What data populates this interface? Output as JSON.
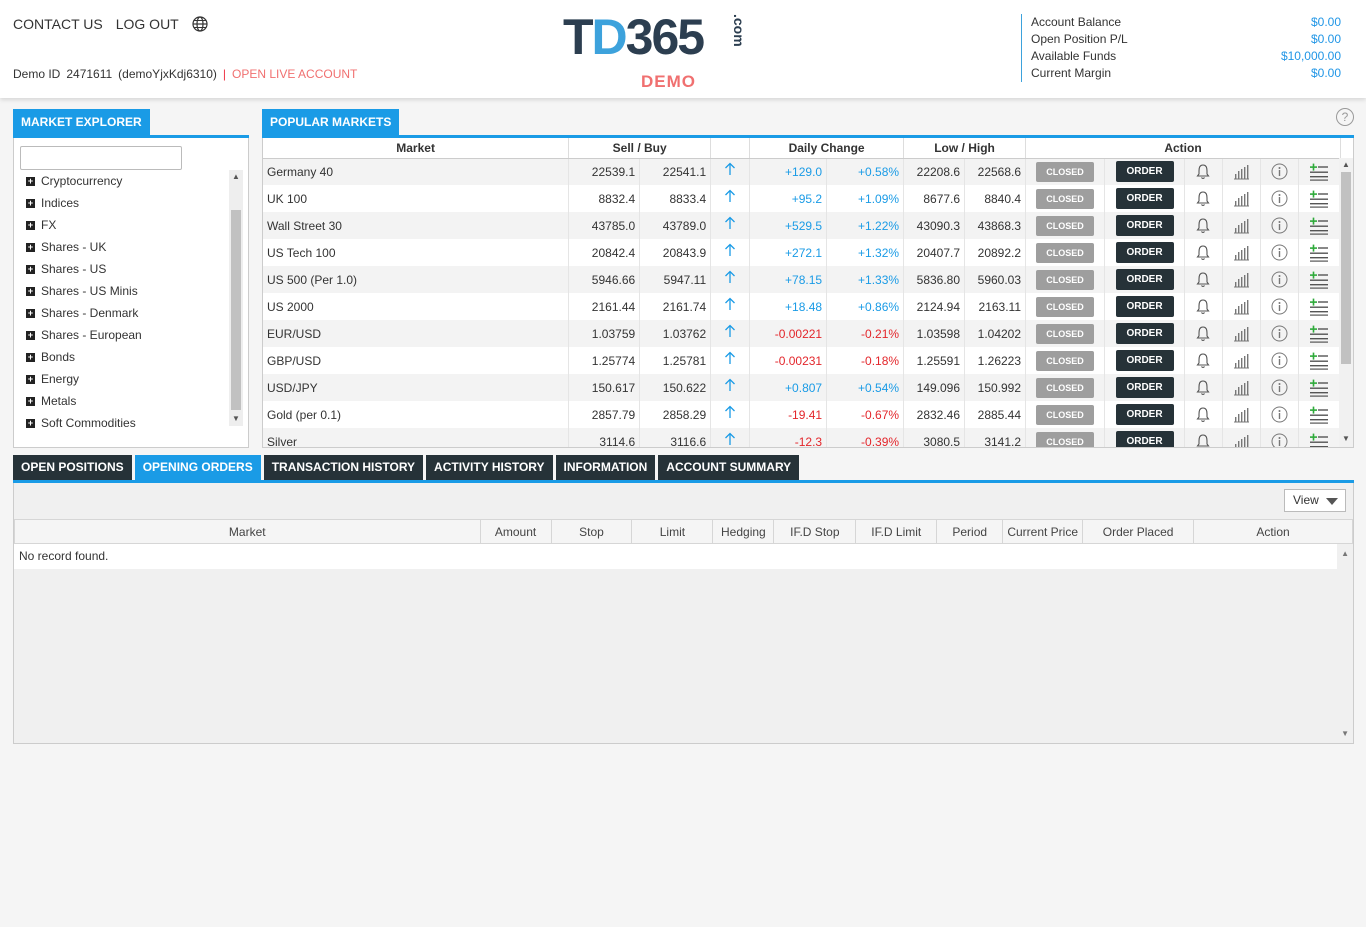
{
  "header": {
    "contact_us": "CONTACT US",
    "log_out": "LOG OUT",
    "demo_id_label": "Demo ID",
    "demo_id_value": "2471611",
    "demo_user": "(demoYjxKdj6310)",
    "open_live": "OPEN LIVE ACCOUNT",
    "logo_t": "T",
    "logo_d": "D",
    "logo_num": "365",
    "logo_com": ".com",
    "demo_badge": "DEMO"
  },
  "account": [
    {
      "label": "Account Balance",
      "value": "$0.00"
    },
    {
      "label": "Open Position P/L",
      "value": "$0.00"
    },
    {
      "label": "Available Funds",
      "value": "$10,000.00"
    },
    {
      "label": "Current Margin",
      "value": "$0.00"
    }
  ],
  "market_explorer": {
    "title": "MARKET EXPLORER",
    "items": [
      "Cryptocurrency",
      "Indices",
      "FX",
      "Shares - UK",
      "Shares - US",
      "Shares - US Minis",
      "Shares - Denmark",
      "Shares - European",
      "Bonds",
      "Energy",
      "Metals",
      "Soft Commodities"
    ]
  },
  "popular_markets": {
    "title": "POPULAR MARKETS",
    "help": "?",
    "headers": {
      "market": "Market",
      "sell_buy": "Sell / Buy",
      "daily_change": "Daily Change",
      "low_high": "Low / High",
      "action": "Action"
    },
    "closed_label": "CLOSED",
    "order_label": "ORDER",
    "rows": [
      {
        "market": "Germany 40",
        "sell": "22539.1",
        "buy": "22541.1",
        "chg": "+129.0",
        "pct": "+0.58%",
        "low": "22208.6",
        "high": "22568.6",
        "dir": "pos"
      },
      {
        "market": "UK 100",
        "sell": "8832.4",
        "buy": "8833.4",
        "chg": "+95.2",
        "pct": "+1.09%",
        "low": "8677.6",
        "high": "8840.4",
        "dir": "pos"
      },
      {
        "market": "Wall Street 30",
        "sell": "43785.0",
        "buy": "43789.0",
        "chg": "+529.5",
        "pct": "+1.22%",
        "low": "43090.3",
        "high": "43868.3",
        "dir": "pos"
      },
      {
        "market": "US Tech 100",
        "sell": "20842.4",
        "buy": "20843.9",
        "chg": "+272.1",
        "pct": "+1.32%",
        "low": "20407.7",
        "high": "20892.2",
        "dir": "pos"
      },
      {
        "market": "US 500 (Per 1.0)",
        "sell": "5946.66",
        "buy": "5947.11",
        "chg": "+78.15",
        "pct": "+1.33%",
        "low": "5836.80",
        "high": "5960.03",
        "dir": "pos"
      },
      {
        "market": "US 2000",
        "sell": "2161.44",
        "buy": "2161.74",
        "chg": "+18.48",
        "pct": "+0.86%",
        "low": "2124.94",
        "high": "2163.11",
        "dir": "pos"
      },
      {
        "market": "EUR/USD",
        "sell": "1.03759",
        "buy": "1.03762",
        "chg": "-0.00221",
        "pct": "-0.21%",
        "low": "1.03598",
        "high": "1.04202",
        "dir": "neg"
      },
      {
        "market": "GBP/USD",
        "sell": "1.25774",
        "buy": "1.25781",
        "chg": "-0.00231",
        "pct": "-0.18%",
        "low": "1.25591",
        "high": "1.26223",
        "dir": "neg"
      },
      {
        "market": "USD/JPY",
        "sell": "150.617",
        "buy": "150.622",
        "chg": "+0.807",
        "pct": "+0.54%",
        "low": "149.096",
        "high": "150.992",
        "dir": "pos"
      },
      {
        "market": "Gold (per 0.1)",
        "sell": "2857.79",
        "buy": "2858.29",
        "chg": "-19.41",
        "pct": "-0.67%",
        "low": "2832.46",
        "high": "2885.44",
        "dir": "neg"
      },
      {
        "market": "Silver",
        "sell": "3114.6",
        "buy": "3116.6",
        "chg": "-12.3",
        "pct": "-0.39%",
        "low": "3080.5",
        "high": "3141.2",
        "dir": "neg"
      }
    ]
  },
  "bottom_tabs": [
    {
      "label": "OPEN POSITIONS",
      "active": false
    },
    {
      "label": "OPENING ORDERS",
      "active": true
    },
    {
      "label": "TRANSACTION HISTORY",
      "active": false
    },
    {
      "label": "ACTIVITY HISTORY",
      "active": false
    },
    {
      "label": "INFORMATION",
      "active": false
    },
    {
      "label": "ACCOUNT SUMMARY",
      "active": false
    }
  ],
  "orders": {
    "view_label": "View",
    "columns": [
      "Market",
      "Amount",
      "Stop",
      "Limit",
      "Hedging",
      "IF.D Stop",
      "IF.D Limit",
      "Period",
      "Current Price",
      "Order Placed",
      "Action"
    ],
    "empty": "No record found."
  },
  "colors": {
    "accent": "#1a9be6",
    "dark": "#263238",
    "negative": "#e3262b",
    "demo": "#f07070"
  }
}
